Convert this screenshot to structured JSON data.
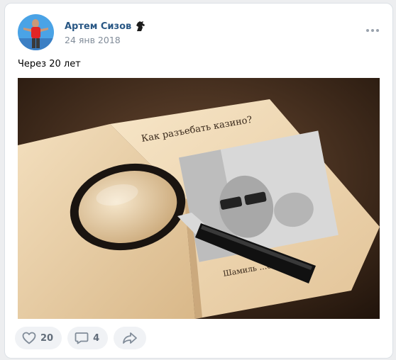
{
  "post": {
    "author_name": "Артем Сизов",
    "date": "24 янв 2018",
    "text": "Через 20 лет",
    "author_badge_icon": "horse-head-icon",
    "menu_icon": "more-dots-icon"
  },
  "photo": {
    "book_title": "Как разъебать казино?",
    "book_author": "Шамиль …енович"
  },
  "actions": {
    "likes_count": "20",
    "comments_count": "4",
    "like_icon": "heart-icon",
    "comment_icon": "comment-icon",
    "share_icon": "share-arrow-icon"
  },
  "colors": {
    "author_link": "#2a5885",
    "secondary_text": "#818c99",
    "action_bg": "#f0f2f5"
  }
}
